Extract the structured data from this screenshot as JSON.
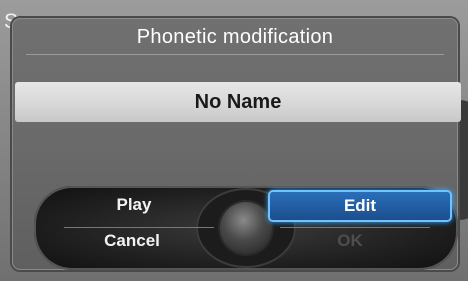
{
  "background": {
    "title_fragment": "S"
  },
  "dialog": {
    "title": "Phonetic modification",
    "name_value": "No Name"
  },
  "controls": {
    "play": "Play",
    "cancel": "Cancel",
    "edit": "Edit",
    "ok": "OK"
  },
  "colors": {
    "selection": "#1c4e8e",
    "selection_glow": "#6fc3ff",
    "disabled_text": "#4e4e4e"
  }
}
